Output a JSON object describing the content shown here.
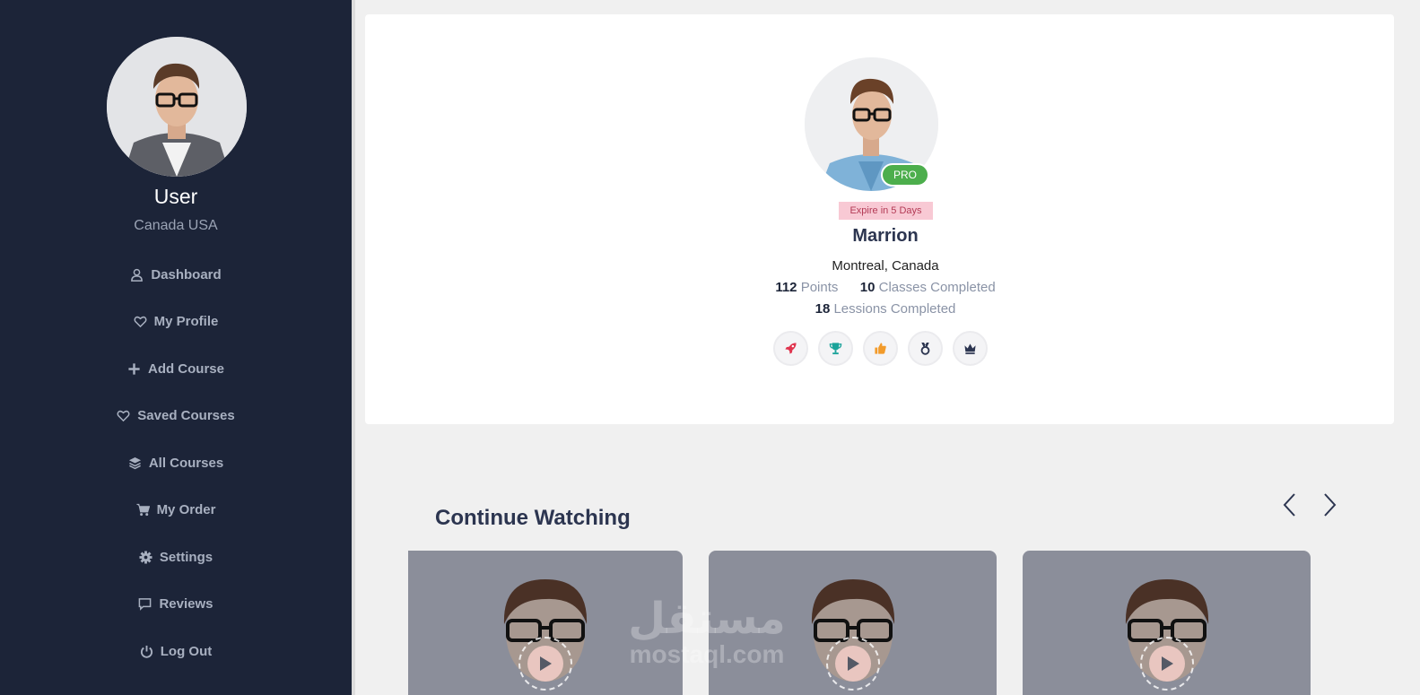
{
  "sidebar": {
    "user_name": "User",
    "location": "Canada USA",
    "nav": [
      {
        "label": "Dashboard",
        "icon": "user-icon"
      },
      {
        "label": "My Profile",
        "icon": "heart-icon"
      },
      {
        "label": "Add Course",
        "icon": "plus-icon"
      },
      {
        "label": "Saved Courses",
        "icon": "heart-icon"
      },
      {
        "label": "All Courses",
        "icon": "layers-icon"
      },
      {
        "label": "My Order",
        "icon": "cart-icon"
      },
      {
        "label": "Settings",
        "icon": "gear-icon"
      },
      {
        "label": "Reviews",
        "icon": "comment-icon"
      },
      {
        "label": "Log Out",
        "icon": "power-icon"
      }
    ]
  },
  "profile": {
    "badge": "PRO",
    "expire": "Expire in 5 Days",
    "name": "Marrion",
    "city": "Montreal, Canada",
    "points_value": "112",
    "points_label": "Points",
    "classes_value": "10",
    "classes_label": "Classes Completed",
    "lessons_value": "18",
    "lessons_label": "Lessions Completed",
    "achievements": [
      {
        "icon": "rocket-icon",
        "color": "#e0344e"
      },
      {
        "icon": "trophy-icon",
        "color": "#1aa39a"
      },
      {
        "icon": "thumbs-up-icon",
        "color": "#f29b2b"
      },
      {
        "icon": "medal-icon",
        "color": "#2c3550"
      },
      {
        "icon": "crown-icon",
        "color": "#2c3550"
      }
    ]
  },
  "continue_watching": {
    "title": "Continue Watching",
    "videos": [
      {
        "icon": "play-icon"
      },
      {
        "icon": "play-icon"
      },
      {
        "icon": "play-icon"
      }
    ]
  },
  "watermark": {
    "arabic": "مستقل",
    "latin": "mostaql.com"
  }
}
